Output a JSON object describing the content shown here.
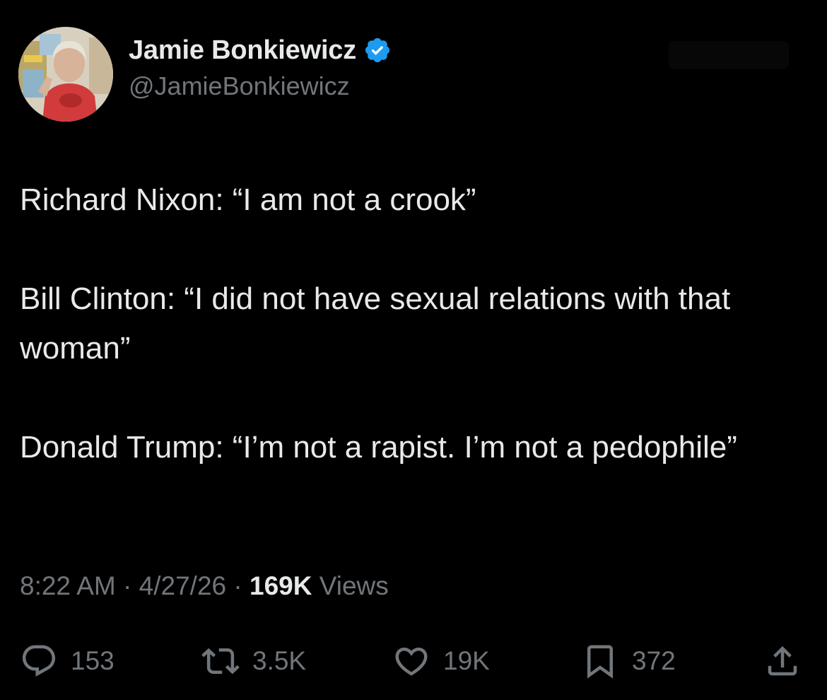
{
  "author": {
    "display_name": "Jamie Bonkiewicz",
    "handle": "@JamieBonkiewicz",
    "verified": true,
    "verified_color": "#1d9bf0",
    "avatar_icon": "profile-photo"
  },
  "tweet": {
    "paragraphs": [
      "Richard Nixon: “I am not a crook”",
      "Bill Clinton: “I did not have sexual relations with that woman”",
      "Donald Trump: “I’m not a rapist. I’m not a pedophile”"
    ],
    "time": "8:22 AM",
    "date": "4/27/26",
    "separator": "·",
    "views_count": "169K",
    "views_label": "Views"
  },
  "actions": {
    "replies": "153",
    "reposts": "3.5K",
    "likes": "19K",
    "bookmarks": "372",
    "icons": [
      "reply-icon",
      "repost-icon",
      "like-icon",
      "bookmark-icon",
      "share-icon"
    ]
  },
  "colors": {
    "background": "#000000",
    "primary_text": "#e7e9ea",
    "secondary_text": "#71767b"
  }
}
